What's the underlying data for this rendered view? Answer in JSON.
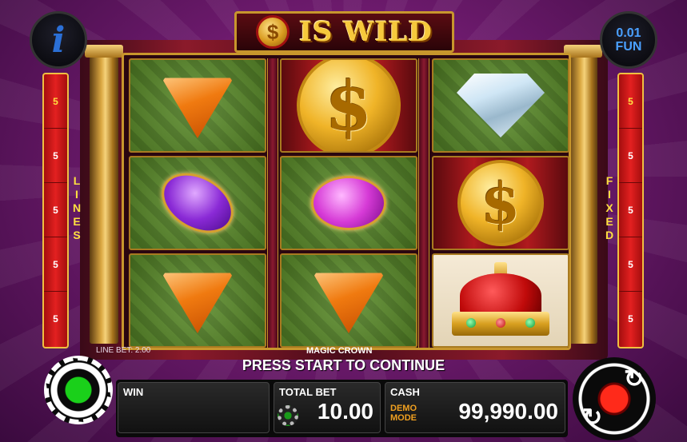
{
  "title": {
    "symbol": "$",
    "text": "IS WILD"
  },
  "info_button": {
    "label": "i"
  },
  "denomination": {
    "value": "0.01",
    "currency": "FUN"
  },
  "lines_bar_left": [
    "5",
    "5",
    "5",
    "5",
    "5"
  ],
  "lines_bar_right": [
    "5",
    "5",
    "5",
    "5",
    "5"
  ],
  "labels": {
    "lines": "LINES",
    "fixed": "FIXED"
  },
  "reels": [
    [
      "orange-trillion-gem",
      "purple-marquise-gem",
      "orange-trillion-gem"
    ],
    [
      "gold-dollar-coin",
      "pink-oval-gem",
      "orange-trillion-gem"
    ],
    [
      "white-diamond",
      "gold-dollar-coin",
      "red-royal-crown"
    ]
  ],
  "coin_symbol": "$",
  "footer": {
    "line_bet": "LINE BET: 2.00",
    "game_name": "MAGIC CROWN",
    "message": "PRESS START TO CONTINUE",
    "win_label": "WIN",
    "total_bet_label": "TOTAL BET",
    "total_bet_value": "10.00",
    "cash_label": "CASH",
    "demo_mode": "DEMO MODE",
    "cash_value": "99,990.00"
  },
  "colors": {
    "accent_gold": "#c8962c",
    "line_bar_red": "#e32020",
    "spin_red": "#ff2a1a",
    "settings_green": "#1ad01a"
  }
}
